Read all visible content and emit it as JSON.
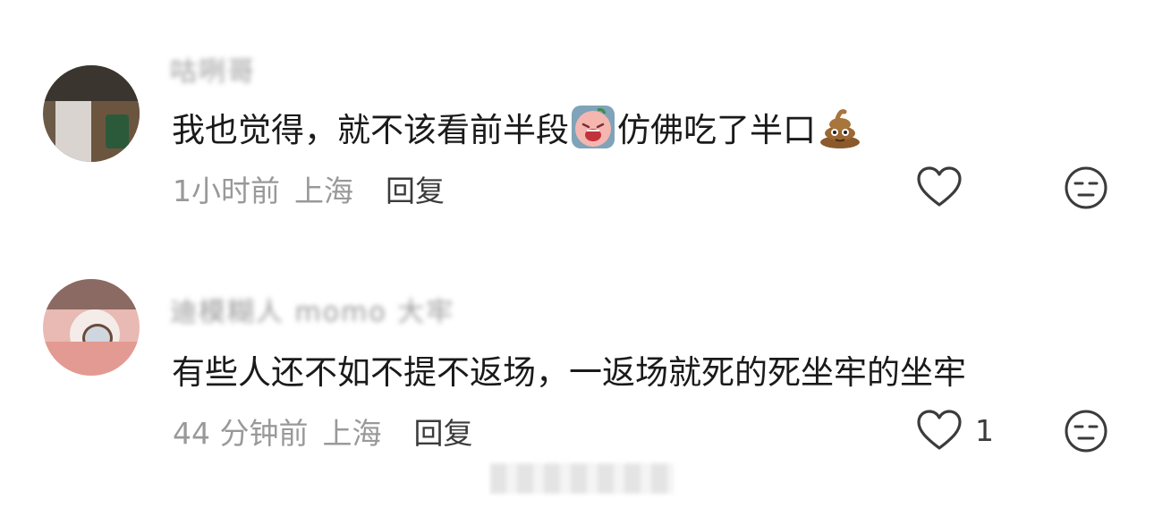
{
  "comments": [
    {
      "username": "咕咧哥",
      "text_before": "我也觉得，就不该看前半段",
      "emoji_1": "crying-face-emoji",
      "text_after": "仿佛吃了半口",
      "emoji_2": "poop-emoji",
      "time": "1小时前",
      "location": "上海",
      "reply_label": "回复",
      "like_count": ""
    },
    {
      "username": "迪模糊人 momo 大牢",
      "text": "有些人还不如不提不返场，一返场就死的死坐牢的坐牢",
      "time": "44 分钟前",
      "location": "上海",
      "reply_label": "回复",
      "like_count": "1"
    }
  ],
  "icons": {
    "like": "heart-outline-icon",
    "dislike": "unamused-face-icon"
  },
  "colors": {
    "text_primary": "#1a1a1a",
    "text_secondary": "#999999",
    "icon": "#3b3b3b"
  }
}
